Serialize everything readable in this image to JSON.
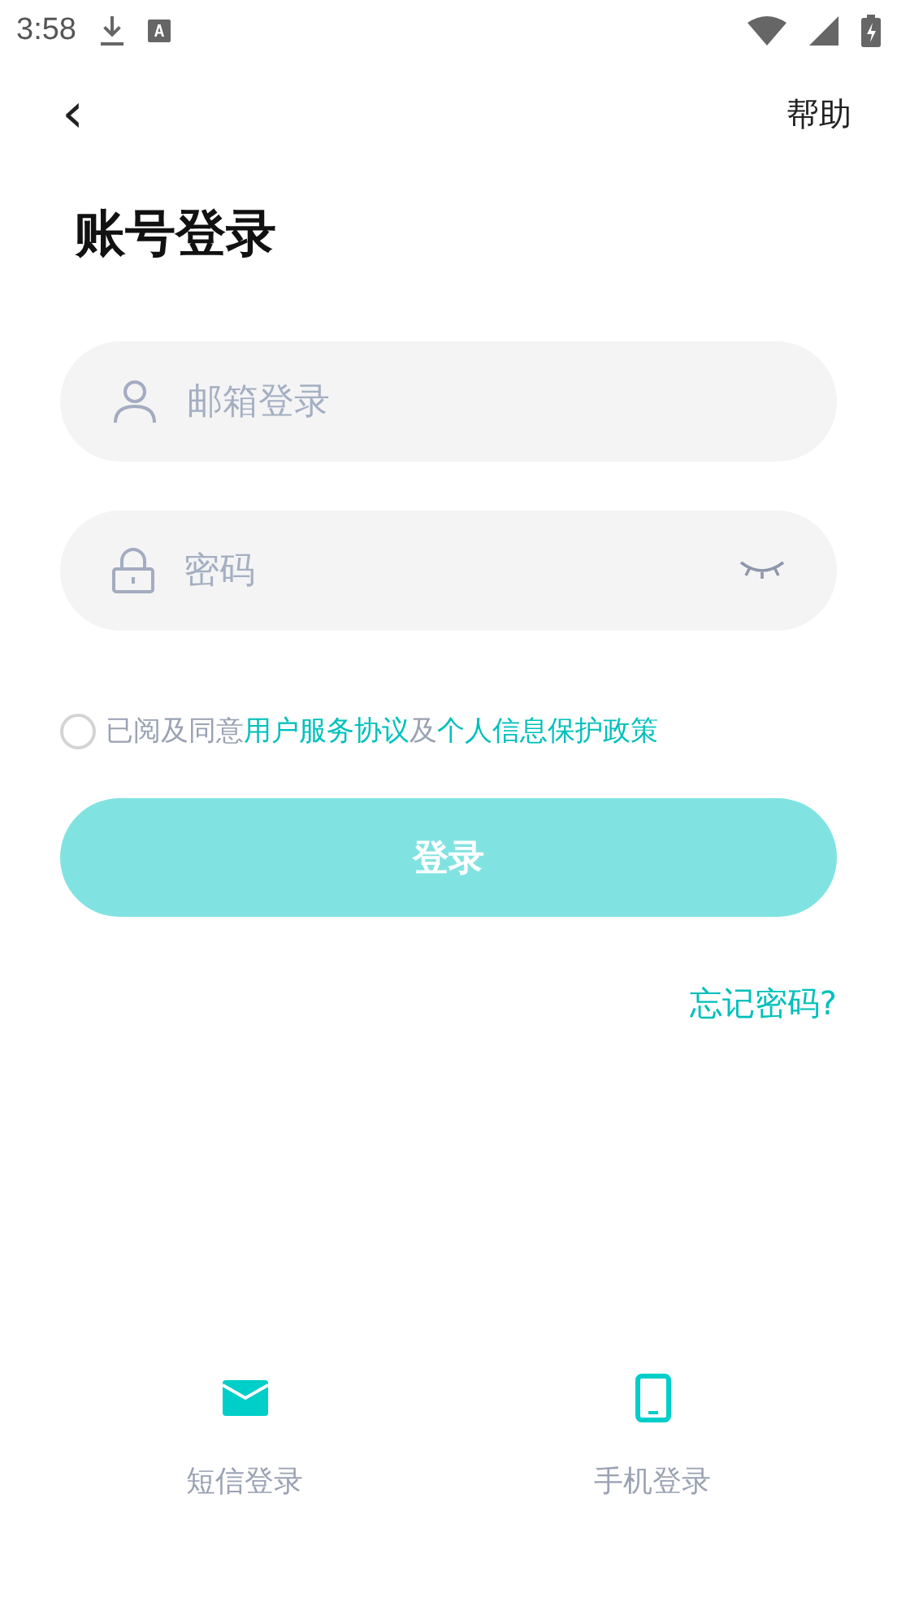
{
  "status_bar": {
    "time": "3:58"
  },
  "nav": {
    "back": "‹",
    "help": "帮助"
  },
  "title": "账号登录",
  "fields": [
    {
      "kind": "account",
      "placeholder": "邮箱登录"
    },
    {
      "kind": "password",
      "placeholder": "密码"
    }
  ],
  "agreement": {
    "checked": false,
    "parts": [
      {
        "kind": "text",
        "text": "已阅及同意"
      },
      {
        "kind": "link",
        "text": "用户服务协议"
      },
      {
        "kind": "text",
        "text": "及"
      },
      {
        "kind": "link",
        "text": "个人信息保护政策"
      }
    ]
  },
  "login_button": {
    "label": "登录",
    "disabled": true
  },
  "forgot": "忘记密码?",
  "alternatives": [
    {
      "kind": "sms",
      "label": "短信登录"
    },
    {
      "kind": "phone",
      "label": "手机登录"
    }
  ]
}
